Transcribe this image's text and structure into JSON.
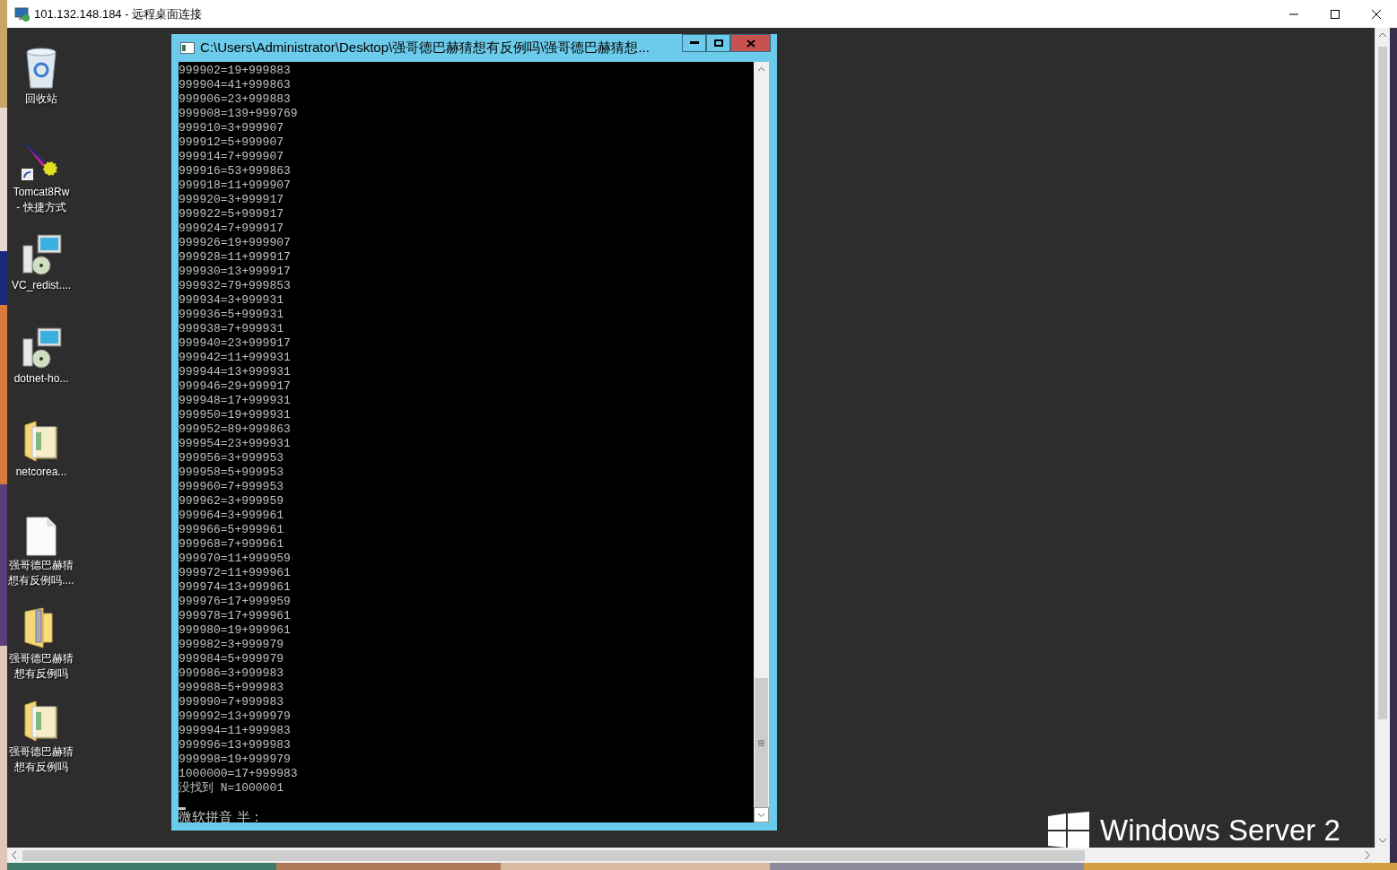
{
  "rdp_window": {
    "title": "101.132.148.184 - 远程桌面连接"
  },
  "desktop_icons": [
    {
      "kind": "recycle",
      "lines": [
        "回收站"
      ]
    },
    {
      "kind": "tomcat",
      "lines": [
        "Tomcat8Rw",
        "- 快捷方式"
      ]
    },
    {
      "kind": "installer",
      "lines": [
        "VC_redist...."
      ]
    },
    {
      "kind": "installer",
      "lines": [
        "dotnet-ho..."
      ]
    },
    {
      "kind": "folder_doc",
      "lines": [
        "netcorea..."
      ]
    },
    {
      "kind": "file",
      "lines": [
        "强哥德巴赫猜",
        "想有反例吗...."
      ]
    },
    {
      "kind": "zip",
      "lines": [
        "强哥德巴赫猜",
        "想有反例吗"
      ]
    },
    {
      "kind": "folder_doc",
      "lines": [
        "强哥德巴赫猜",
        "想有反例吗"
      ]
    }
  ],
  "console": {
    "title": "C:\\Users\\Administrator\\Desktop\\强哥德巴赫猜想有反例吗\\强哥德巴赫猜想...",
    "lines": [
      "999902=19+999883",
      "999904=41+999863",
      "999906=23+999883",
      "999908=139+999769",
      "999910=3+999907",
      "999912=5+999907",
      "999914=7+999907",
      "999916=53+999863",
      "999918=11+999907",
      "999920=3+999917",
      "999922=5+999917",
      "999924=7+999917",
      "999926=19+999907",
      "999928=11+999917",
      "999930=13+999917",
      "999932=79+999853",
      "999934=3+999931",
      "999936=5+999931",
      "999938=7+999931",
      "999940=23+999917",
      "999942=11+999931",
      "999944=13+999931",
      "999946=29+999917",
      "999948=17+999931",
      "999950=19+999931",
      "999952=89+999863",
      "999954=23+999931",
      "999956=3+999953",
      "999958=5+999953",
      "999960=7+999953",
      "999962=3+999959",
      "999964=3+999961",
      "999966=5+999961",
      "999968=7+999961",
      "999970=11+999959",
      "999972=11+999961",
      "999974=13+999961",
      "999976=17+999959",
      "999978=17+999961",
      "999980=19+999961",
      "999982=3+999979",
      "999984=5+999979",
      "999986=3+999983",
      "999988=5+999983",
      "999990=7+999983",
      "999992=13+999979",
      "999994=11+999983",
      "999996=13+999983",
      "999998=19+999979",
      "1000000=17+999983",
      "没找到 N=1000001"
    ],
    "ime_status": "微软拼音 半 :"
  },
  "branding": {
    "text": "Windows Server 2"
  }
}
